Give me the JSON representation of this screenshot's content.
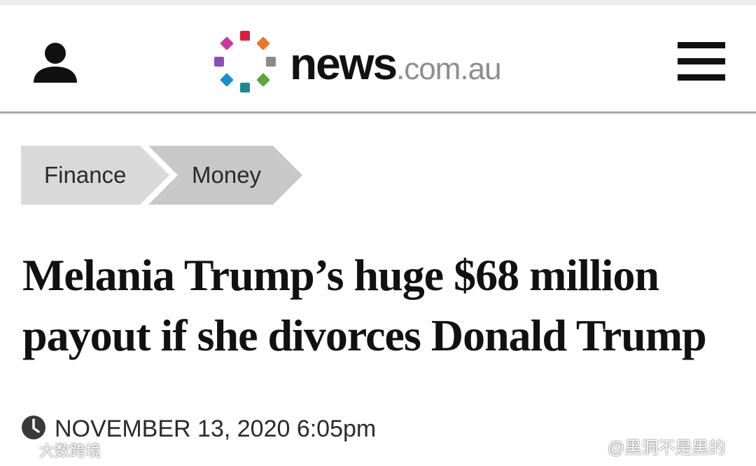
{
  "header": {
    "user_icon": "user-silhouette-icon",
    "logo": {
      "name": "news.com.au",
      "wordmark_main": "news",
      "wordmark_tld": ".com.au",
      "dot_colors": [
        "#d4213d",
        "#e8782a",
        "#8a8a8a",
        "#5aa83b",
        "#1b8a8f",
        "#1a8fd0",
        "#8c4fb5",
        "#c93a9e"
      ]
    },
    "menu_icon": "hamburger-menu-icon"
  },
  "breadcrumb": {
    "items": [
      {
        "label": "Finance"
      },
      {
        "label": "Money"
      }
    ],
    "colors": {
      "first": "#d9d9d9",
      "second": "#c8c8c8"
    }
  },
  "article": {
    "headline": "Melania Trump’s huge $68 million payout if she divorces Donald Trump",
    "clock_icon": "clock-icon",
    "timestamp": "NOVEMBER 13, 2020 6:05pm"
  },
  "watermarks": {
    "left": {
      "icon": "dashuju-logo-icon",
      "text": "大数跨境"
    },
    "right": {
      "icon": "weibo-icon",
      "text": "@黑洞不是黑的"
    }
  }
}
